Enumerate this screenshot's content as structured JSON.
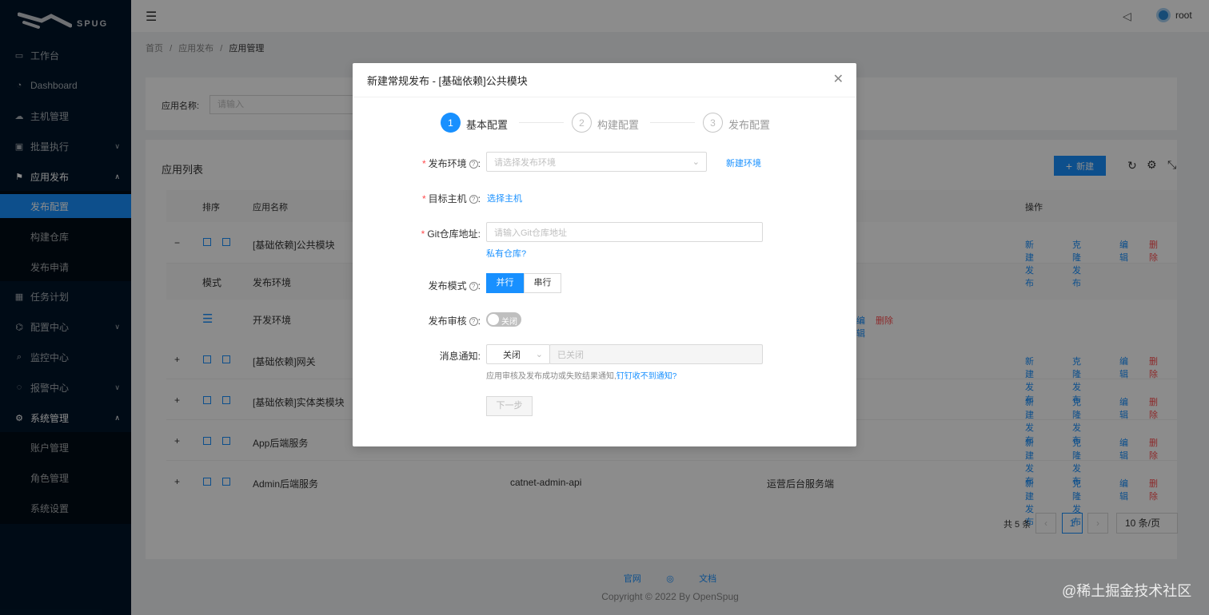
{
  "app": {
    "logo_text": "SPUG"
  },
  "sidebar": {
    "items": [
      {
        "label": "工作台",
        "icon": "monitor-icon"
      },
      {
        "label": "Dashboard",
        "icon": "dashboard-icon"
      },
      {
        "label": "主机管理",
        "icon": "cloud-server-icon"
      },
      {
        "label": "批量执行",
        "icon": "code-icon"
      },
      {
        "label": "应用发布",
        "icon": "flag-icon"
      },
      {
        "label": "任务计划",
        "icon": "schedule-icon"
      },
      {
        "label": "配置中心",
        "icon": "deployment-icon"
      },
      {
        "label": "监控中心",
        "icon": "monitor-search-icon"
      },
      {
        "label": "报警中心",
        "icon": "alert-icon"
      },
      {
        "label": "系统管理",
        "icon": "settings-icon"
      }
    ],
    "sub_publish": [
      "发布配置",
      "构建仓库",
      "发布申请"
    ],
    "sub_system": [
      "账户管理",
      "角色管理",
      "系统设置"
    ]
  },
  "header": {
    "user": "root"
  },
  "breadcrumb": [
    "首页",
    "应用发布",
    "应用管理"
  ],
  "filter": {
    "label": "应用名称:",
    "placeholder": "请输入"
  },
  "list": {
    "title": "应用列表",
    "new_button": "新建",
    "columns": [
      "排序",
      "应用名称",
      "操作"
    ],
    "sub_columns": [
      "模式",
      "发布环境"
    ],
    "rows": [
      {
        "expand": "−",
        "name": "[基础依赖]公共模块",
        "key": "",
        "desc": ""
      },
      {
        "expand": "+",
        "name": "[基础依赖]网关",
        "key": "",
        "desc": ""
      },
      {
        "expand": "+",
        "name": "[基础依赖]实体类模块",
        "key": "",
        "desc": ""
      },
      {
        "expand": "+",
        "name": "App后端服务",
        "key": "",
        "desc": ""
      },
      {
        "expand": "+",
        "name": "Admin后端服务",
        "key": "catnet-admin-api",
        "desc": "运营后台服务端"
      }
    ],
    "sub_row": {
      "env": "开发环境",
      "edit_partial": "编辑",
      "delete": "删除"
    },
    "ops": {
      "new_publish": "新建发布",
      "clone_publish": "克隆发布",
      "edit": "编辑",
      "delete": "删除"
    },
    "pagination": {
      "total": "共 5 条",
      "page": "1",
      "page_size": "10 条/页"
    }
  },
  "footer": {
    "links": [
      "官网",
      "文档"
    ],
    "copyright": "Copyright © 2022 By OpenSpug"
  },
  "watermark": "@稀土掘金技术社区",
  "modal": {
    "title": "新建常规发布 - [基础依赖]公共模块",
    "steps": [
      {
        "num": "1",
        "label": "基本配置"
      },
      {
        "num": "2",
        "label": "构建配置"
      },
      {
        "num": "3",
        "label": "发布配置"
      }
    ],
    "env_label": "发布环境",
    "env_placeholder": "请选择发布环境",
    "new_env_link": "新建环境",
    "host_label": "目标主机",
    "host_link": "选择主机",
    "git_label": "Git仓库地址",
    "git_placeholder": "请输入Git仓库地址",
    "private_repo_link": "私有仓库?",
    "mode_label": "发布模式",
    "mode_parallel": "并行",
    "mode_serial": "串行",
    "review_label": "发布审核",
    "review_toggle": "关闭",
    "notify_label": "消息通知:",
    "notify_select": "关闭",
    "notify_input": "已关闭",
    "notify_help": "应用审核及发布成功或失败结果通知,",
    "notify_help_link": "钉钉收不到通知?",
    "next_button": "下一步"
  }
}
